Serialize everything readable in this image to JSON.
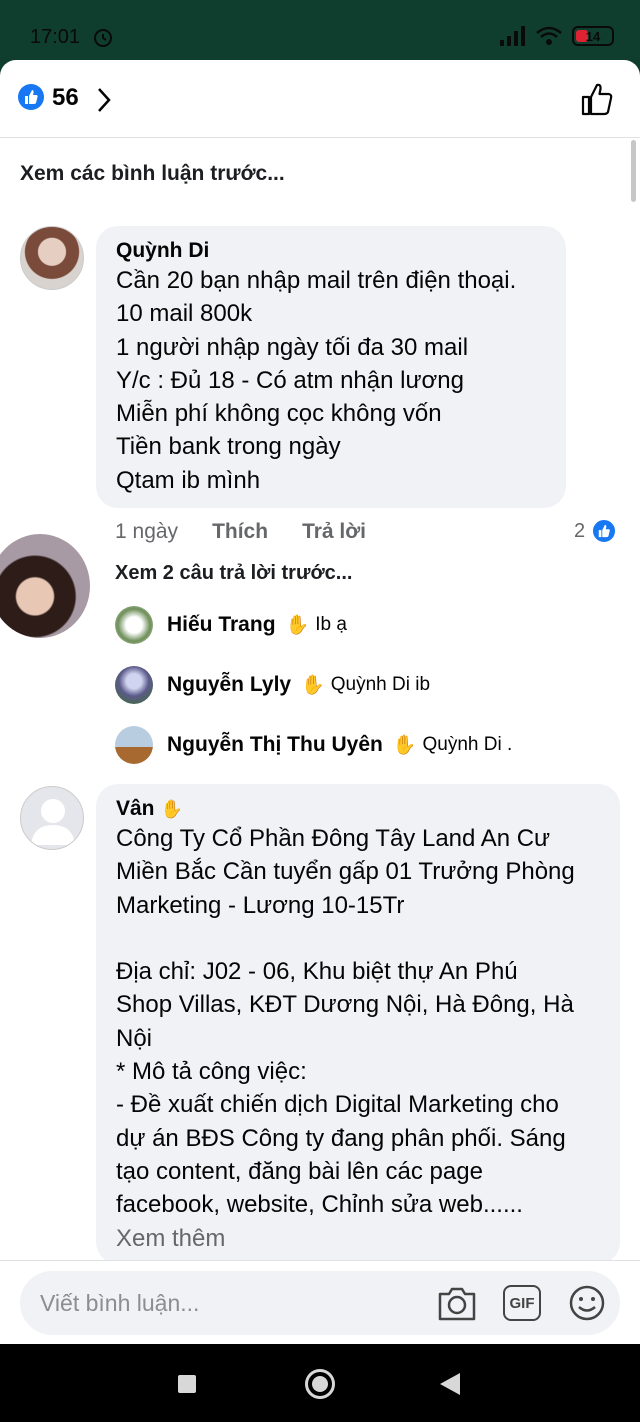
{
  "status": {
    "time": "17:01",
    "battery": "14"
  },
  "header": {
    "like_count": "56"
  },
  "comments_link": "Xem các bình luận trước...",
  "comment1": {
    "author": "Quỳnh Di",
    "text": "Cần 20 bạn nhập mail trên điện thoại.\n10 mail 800k\n1 người nhập ngày tối đa 30 mail\nY/c : Đủ 18 - Có atm nhận lương\nMiễn phí không cọc không vốn\nTiền bank trong ngày\nQtam ib mình",
    "time": "1 ngày",
    "like_label": "Thích",
    "reply_label": "Trả lời",
    "reaction_count": "2",
    "view_replies": "Xem 2 câu trả lời trước...",
    "replies": [
      {
        "name": "Hiếu Trang",
        "text": "Ib ạ"
      },
      {
        "name": "Nguyễn Lyly",
        "text": "Quỳnh Di ib"
      },
      {
        "name": "Nguyễn Thị Thu Uyên",
        "text": "Quỳnh Di ."
      }
    ]
  },
  "comment2": {
    "author": "Vân",
    "text": "Công Ty Cổ Phần Đông Tây Land An Cư\nMiền Bắc Cần tuyển gấp 01 Trưởng Phòng\nMarketing - Lương 10-15Tr\n\nĐịa chỉ: J02 - 06, Khu biệt thự An Phú\nShop Villas, KĐT Dương Nội, Hà Đông, Hà\nNội\n* Mô tả công việc:\n- Đề xuất chiến dịch Digital Marketing cho\ndự án BĐS Công ty đang phân phối. Sáng\ntạo content, đăng bài lên các page\nfacebook, website, Chỉnh sửa web......",
    "see_more": "Xem thêm"
  },
  "composer": {
    "placeholder": "Viết bình luận...",
    "gif_label": "GIF"
  },
  "colors": {
    "accent": "#1877f2",
    "bubble": "#f0f2f5",
    "muted": "#65676b"
  }
}
